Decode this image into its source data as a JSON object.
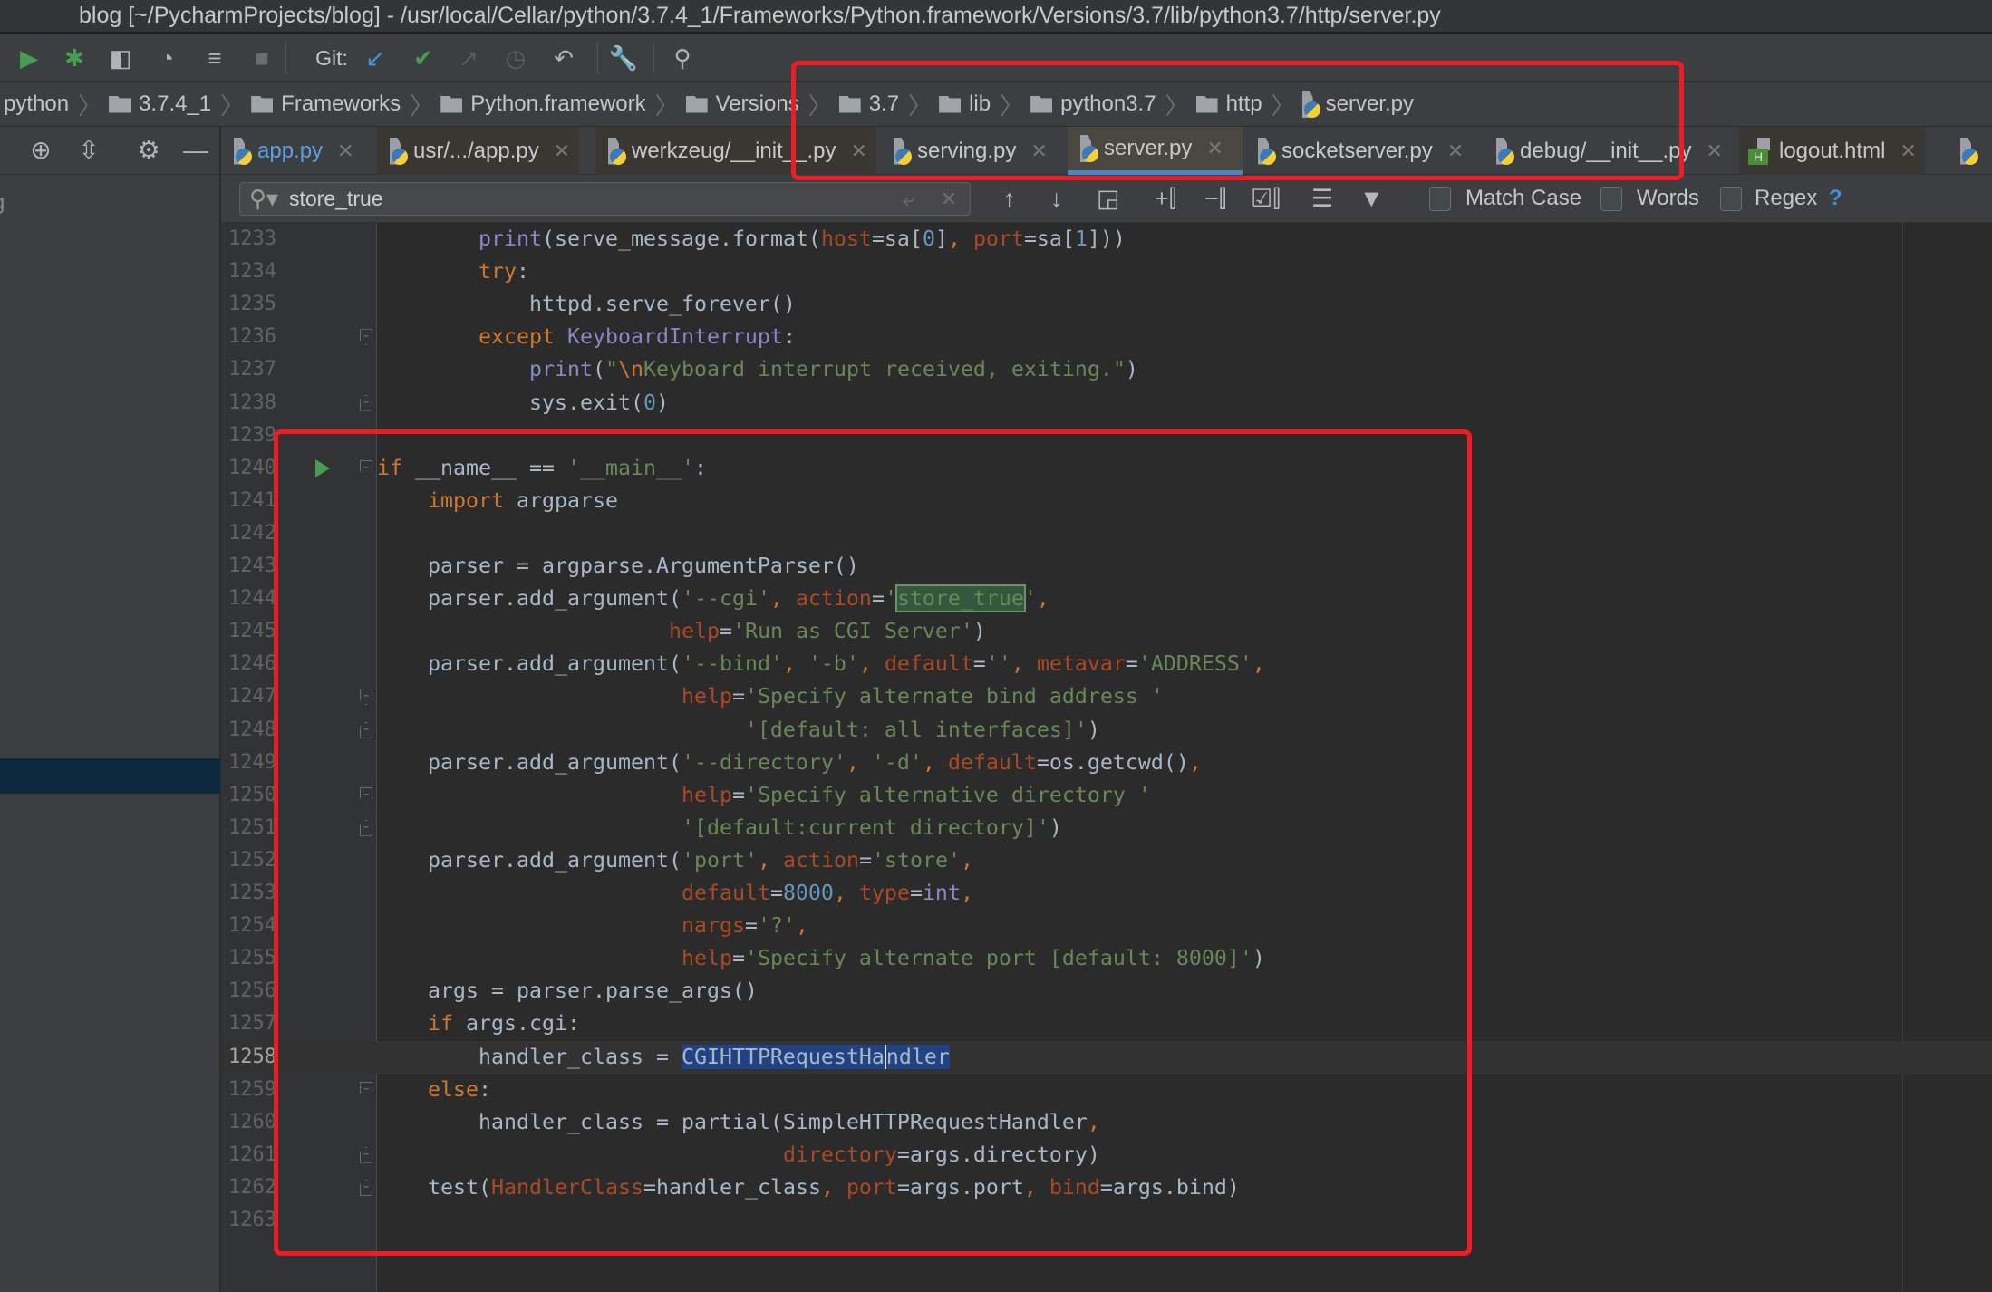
{
  "window": {
    "title": "blog [~/PycharmProjects/blog] - /usr/local/Cellar/python/3.7.4_1/Frameworks/Python.framework/Versions/3.7/lib/python3.7/http/server.py"
  },
  "toolbar": {
    "git_label": "Git:",
    "icons": [
      "run-icon",
      "debug-icon",
      "coverage-icon",
      "profile-icon",
      "run-concurrency-icon",
      "stop-icon",
      "git-update-icon",
      "git-commit-icon",
      "git-push-icon",
      "history-icon",
      "revert-icon",
      "wrench-icon",
      "search-icon"
    ]
  },
  "breadcrumb": [
    "python",
    "3.7.4_1",
    "Frameworks",
    "Python.framework",
    "Versions",
    "3.7",
    "lib",
    "python3.7",
    "http",
    "server.py"
  ],
  "tabs": [
    {
      "label": "app.py",
      "active": false
    },
    {
      "label": "usr/.../app.py",
      "active": false
    },
    {
      "label": "werkzeug/__init__.py",
      "active": false
    },
    {
      "label": "serving.py",
      "active": false
    },
    {
      "label": "server.py",
      "active": true
    },
    {
      "label": "socketserver.py",
      "active": false
    },
    {
      "label": "debug/__init__.py",
      "active": false
    },
    {
      "label": "logout.html",
      "active": false
    }
  ],
  "left_panel": {
    "fragment": "g"
  },
  "search": {
    "query": "store_true",
    "match_case": {
      "label": "Match Case",
      "checked": false
    },
    "words": {
      "label": "Words",
      "checked": false
    },
    "regex": {
      "label": "Regex",
      "checked": false
    },
    "help": "?"
  },
  "colors": {
    "accent": "#4a88c7",
    "annotation": "#ee1c24",
    "selection": "#214283",
    "search_match": "#32593d",
    "run_gutter": "#499c54"
  },
  "code": {
    "current_line": 1258,
    "lines": [
      {
        "num": "1233",
        "tokens": [
          [
            "d",
            "        "
          ],
          [
            "b",
            "print"
          ],
          [
            "d",
            "(serve_message.format("
          ],
          [
            "p",
            "host"
          ],
          [
            "d",
            "=sa["
          ],
          [
            "n",
            "0"
          ],
          [
            "d",
            "]"
          ],
          [
            "k",
            ", "
          ],
          [
            "p",
            "port"
          ],
          [
            "d",
            "=sa["
          ],
          [
            "n",
            "1"
          ],
          [
            "d",
            "]))"
          ]
        ]
      },
      {
        "num": "1234",
        "tokens": [
          [
            "d",
            "        "
          ],
          [
            "k",
            "try"
          ],
          [
            "d",
            ":"
          ]
        ]
      },
      {
        "num": "1235",
        "tokens": [
          [
            "d",
            "            httpd.serve_forever()"
          ]
        ]
      },
      {
        "num": "1236",
        "fold": "open",
        "tokens": [
          [
            "d",
            "        "
          ],
          [
            "k",
            "except "
          ],
          [
            "b",
            "KeyboardInterrupt"
          ],
          [
            "d",
            ":"
          ]
        ]
      },
      {
        "num": "1237",
        "tokens": [
          [
            "d",
            "            "
          ],
          [
            "b",
            "print"
          ],
          [
            "d",
            "("
          ],
          [
            "s",
            "\""
          ],
          [
            "e",
            "\\n"
          ],
          [
            "s",
            "Keyboard interrupt received, exiting.\""
          ],
          [
            "d",
            ")"
          ]
        ]
      },
      {
        "num": "1238",
        "fold": "close",
        "tokens": [
          [
            "d",
            "            sys.exit("
          ],
          [
            "n",
            "0"
          ],
          [
            "d",
            ")"
          ]
        ]
      },
      {
        "num": "1239",
        "tokens": []
      },
      {
        "num": "1240",
        "fold": "open",
        "run": true,
        "tokens": [
          [
            "k",
            "if "
          ],
          [
            "d",
            "__name__ == "
          ],
          [
            "s",
            "'__main__'"
          ],
          [
            "d",
            ":"
          ]
        ]
      },
      {
        "num": "1241",
        "tokens": [
          [
            "d",
            "    "
          ],
          [
            "k",
            "import "
          ],
          [
            "d",
            "argparse"
          ]
        ]
      },
      {
        "num": "1242",
        "tokens": []
      },
      {
        "num": "1243",
        "tokens": [
          [
            "d",
            "    parser = argparse.ArgumentParser()"
          ]
        ]
      },
      {
        "num": "1244",
        "tokens": [
          [
            "d",
            "    parser.add_argument("
          ],
          [
            "s",
            "'--cgi'"
          ],
          [
            "k",
            ", "
          ],
          [
            "p",
            "action"
          ],
          [
            "d",
            "="
          ],
          [
            "s",
            "'"
          ],
          [
            "search",
            "store_true"
          ],
          [
            "s",
            "'"
          ],
          [
            "k",
            ","
          ]
        ]
      },
      {
        "num": "1245",
        "tokens": [
          [
            "d",
            "                       "
          ],
          [
            "p",
            "help"
          ],
          [
            "d",
            "="
          ],
          [
            "s",
            "'Run as CGI Server'"
          ],
          [
            "d",
            ")"
          ]
        ]
      },
      {
        "num": "1246",
        "tokens": [
          [
            "d",
            "    parser.add_argument("
          ],
          [
            "s",
            "'--bind'"
          ],
          [
            "k",
            ", "
          ],
          [
            "s",
            "'-b'"
          ],
          [
            "k",
            ", "
          ],
          [
            "p",
            "default"
          ],
          [
            "d",
            "="
          ],
          [
            "s",
            "''"
          ],
          [
            "k",
            ", "
          ],
          [
            "p",
            "metavar"
          ],
          [
            "d",
            "="
          ],
          [
            "s",
            "'ADDRESS'"
          ],
          [
            "k",
            ","
          ]
        ]
      },
      {
        "num": "1247",
        "fold": "open",
        "tokens": [
          [
            "d",
            "                        "
          ],
          [
            "p",
            "help"
          ],
          [
            "d",
            "="
          ],
          [
            "s",
            "'Specify alternate bind address '"
          ]
        ]
      },
      {
        "num": "1248",
        "fold": "close",
        "tokens": [
          [
            "d",
            "                             "
          ],
          [
            "s",
            "'[default: all interfaces]'"
          ],
          [
            "d",
            ")"
          ]
        ]
      },
      {
        "num": "1249",
        "tokens": [
          [
            "d",
            "    parser.add_argument("
          ],
          [
            "s",
            "'--directory'"
          ],
          [
            "k",
            ", "
          ],
          [
            "s",
            "'-d'"
          ],
          [
            "k",
            ", "
          ],
          [
            "p",
            "default"
          ],
          [
            "d",
            "=os.getcwd()"
          ],
          [
            "k",
            ","
          ]
        ]
      },
      {
        "num": "1250",
        "fold": "open",
        "tokens": [
          [
            "d",
            "                        "
          ],
          [
            "p",
            "help"
          ],
          [
            "d",
            "="
          ],
          [
            "s",
            "'Specify alternative directory '"
          ]
        ]
      },
      {
        "num": "1251",
        "fold": "close",
        "tokens": [
          [
            "d",
            "                        "
          ],
          [
            "s",
            "'[default:current directory]'"
          ],
          [
            "d",
            ")"
          ]
        ]
      },
      {
        "num": "1252",
        "tokens": [
          [
            "d",
            "    parser.add_argument("
          ],
          [
            "s",
            "'port'"
          ],
          [
            "k",
            ", "
          ],
          [
            "p",
            "action"
          ],
          [
            "d",
            "="
          ],
          [
            "s",
            "'store'"
          ],
          [
            "k",
            ","
          ]
        ]
      },
      {
        "num": "1253",
        "tokens": [
          [
            "d",
            "                        "
          ],
          [
            "p",
            "default"
          ],
          [
            "d",
            "="
          ],
          [
            "n",
            "8000"
          ],
          [
            "k",
            ", "
          ],
          [
            "p",
            "type"
          ],
          [
            "d",
            "="
          ],
          [
            "b",
            "int"
          ],
          [
            "k",
            ","
          ]
        ]
      },
      {
        "num": "1254",
        "tokens": [
          [
            "d",
            "                        "
          ],
          [
            "p",
            "nargs"
          ],
          [
            "d",
            "="
          ],
          [
            "s",
            "'?'"
          ],
          [
            "k",
            ","
          ]
        ]
      },
      {
        "num": "1255",
        "tokens": [
          [
            "d",
            "                        "
          ],
          [
            "p",
            "help"
          ],
          [
            "d",
            "="
          ],
          [
            "s",
            "'Specify alternate port [default: 8000]'"
          ],
          [
            "d",
            ")"
          ]
        ]
      },
      {
        "num": "1256",
        "tokens": [
          [
            "d",
            "    args = parser.parse_args()"
          ]
        ]
      },
      {
        "num": "1257",
        "tokens": [
          [
            "d",
            "    "
          ],
          [
            "k",
            "if "
          ],
          [
            "d",
            "args.cgi:"
          ]
        ]
      },
      {
        "num": "1258",
        "tokens": [
          [
            "d",
            "        handler_class = "
          ],
          [
            "sel",
            "CGIHTTPRequestHa"
          ],
          [
            "sel caret",
            "ndler"
          ]
        ]
      },
      {
        "num": "1259",
        "fold": "open",
        "tokens": [
          [
            "d",
            "    "
          ],
          [
            "k",
            "else"
          ],
          [
            "d",
            ":"
          ]
        ]
      },
      {
        "num": "1260",
        "tokens": [
          [
            "d",
            "        handler_class = partial(SimpleHTTPRequestHandler"
          ],
          [
            "k",
            ","
          ]
        ]
      },
      {
        "num": "1261",
        "fold": "close",
        "tokens": [
          [
            "d",
            "                                "
          ],
          [
            "p",
            "directory"
          ],
          [
            "d",
            "=args.directory)"
          ]
        ]
      },
      {
        "num": "1262",
        "fold": "close",
        "tokens": [
          [
            "d",
            "    test("
          ],
          [
            "p",
            "HandlerClass"
          ],
          [
            "d",
            "=handler_class"
          ],
          [
            "k",
            ", "
          ],
          [
            "p",
            "port"
          ],
          [
            "d",
            "=args.port"
          ],
          [
            "k",
            ", "
          ],
          [
            "p",
            "bind"
          ],
          [
            "d",
            "=args.bind)"
          ]
        ]
      },
      {
        "num": "1263",
        "tokens": []
      }
    ]
  }
}
